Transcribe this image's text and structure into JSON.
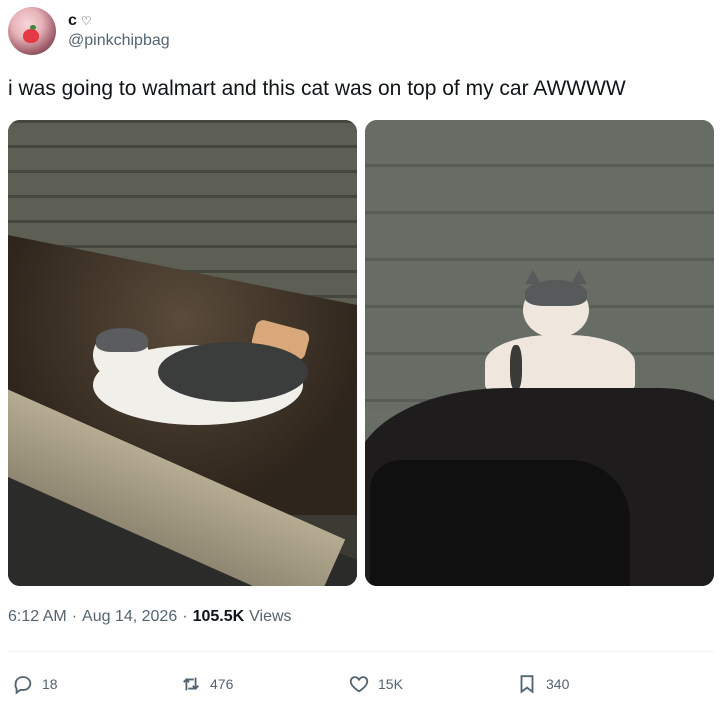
{
  "author": {
    "display_name": "c",
    "name_emoji": "♡",
    "handle": "@pinkchipbag"
  },
  "tweet": {
    "text": "i was going to walmart and this cat was on top of my car AWWWW"
  },
  "meta": {
    "time": "6:12 AM",
    "separator": "·",
    "date": "Aug 14, 2026",
    "views_count": "105.5K",
    "views_label": "Views"
  },
  "actions": {
    "replies": "18",
    "reposts": "476",
    "likes": "15K",
    "bookmarks": "340"
  },
  "icons": {
    "reply": "reply-icon",
    "repost": "repost-icon",
    "like": "heart-icon",
    "bookmark": "bookmark-icon"
  }
}
